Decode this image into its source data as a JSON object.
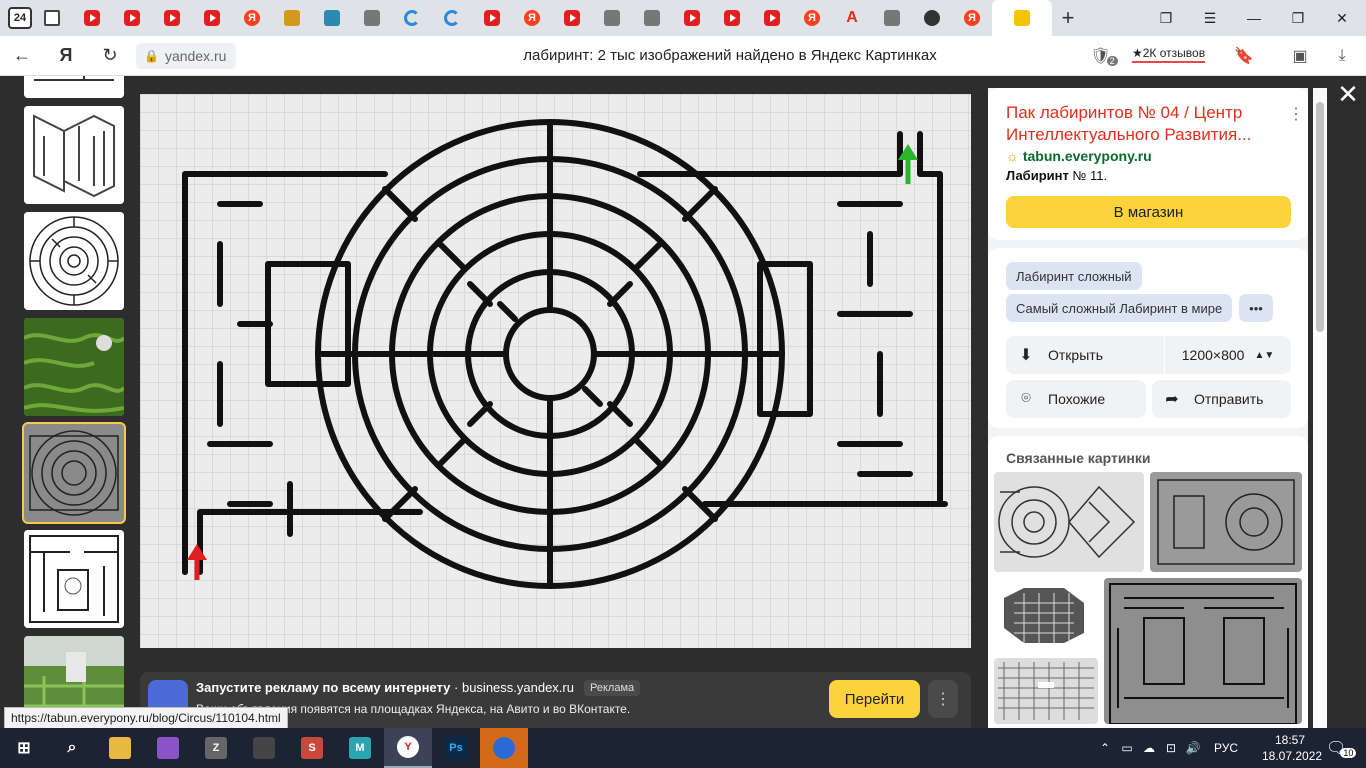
{
  "tabs": {
    "count": "24",
    "favicons": [
      "tab-list-icon",
      "youtube-icon",
      "youtube-icon",
      "youtube-icon",
      "youtube-icon",
      "yandex-icon",
      "gold-icon",
      "teal-icon",
      "unity-icon",
      "ring-icon",
      "ring-icon",
      "youtube-icon",
      "yandex-icon",
      "youtube-icon",
      "unity-icon",
      "unity-icon",
      "youtube-icon",
      "youtube-icon",
      "youtube-icon",
      "yandex-icon",
      "aimp-icon",
      "unity-icon",
      "dark-icon",
      "yandex-icon"
    ],
    "active_favicon": "images-icon",
    "add": "+"
  },
  "addressbar": {
    "domain": "yandex.ru",
    "title": "лабиринт: 2 тыс изображений найдено в Яндекс Картинках",
    "reviews": "★2К отзывов",
    "notif_count": "2"
  },
  "ad": {
    "title": "Запустите рекламу по всему интернету",
    "domain": "· business.yandex.ru",
    "badge": "Реклама",
    "text": "Ваши объявления появятся на площадках Яндекса, на Авито и во ВКонтакте.",
    "go": "Перейти",
    "more": "⋮"
  },
  "status_url": "https://tabun.everypony.ru/blog/Circus/110104.html",
  "panel": {
    "title": "Пак лабиринтов № 04 / Центр Интеллектуального Развития...",
    "source": "tabun.everypony.ru",
    "desc_bold": "Лабиринт",
    "desc_rest": " № 11.",
    "shop_btn": "В магазин",
    "chips": [
      "Лабиринт сложный",
      "Самый сложный Лабиринт в мире",
      "•••"
    ],
    "open": "Открыть",
    "size": "1200×800",
    "similar": "Похожие",
    "send": "Отправить",
    "related_title": "Связанные картинки"
  },
  "taskbar": {
    "lang": "РУС",
    "time": "18:57",
    "date": "18.07.2022",
    "notif": "10"
  }
}
